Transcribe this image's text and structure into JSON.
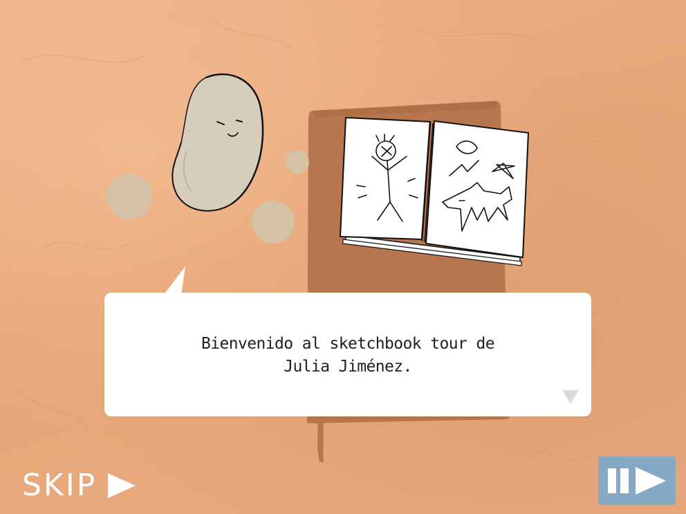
{
  "dialog": {
    "line1": "Bienvenido al sketchbook tour de",
    "line2": "Julia Jiménez."
  },
  "controls": {
    "skip_label": "SKIP",
    "skip_icon": "play-arrow-icon",
    "pause_play_icon": "pause-play-icon",
    "next_icon": "down-triangle-icon"
  },
  "colors": {
    "background": "#e8a97c",
    "notebook": "#b8764f",
    "character": "#d7cdbd",
    "bubbles": "#d2c3a8",
    "dialog_box": "#ffffff",
    "button": "#85a8c5"
  }
}
